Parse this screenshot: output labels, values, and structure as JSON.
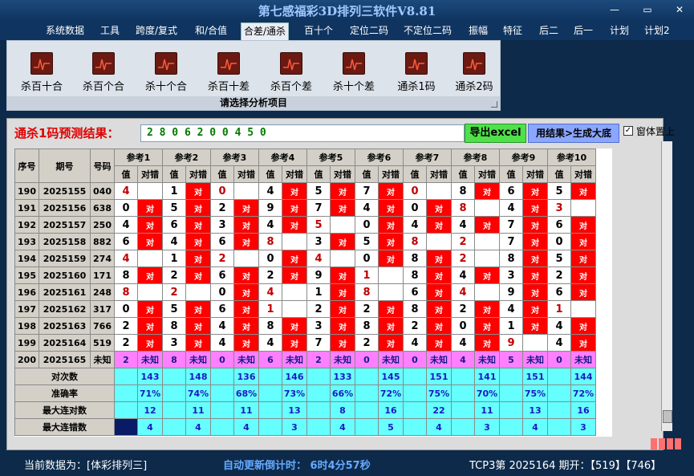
{
  "window": {
    "title": "第七感福彩3D排列三软件V8.81"
  },
  "menu": [
    "系统数据",
    "工具",
    "跨度/复式",
    "和/合值",
    "合差/通杀",
    "百十个",
    "定位二码",
    "不定位二码",
    "振幅",
    "特征",
    "后二",
    "后一",
    "计划",
    "计划2"
  ],
  "menu_active": 4,
  "ribbon": {
    "buttons": [
      "杀百十合",
      "杀百个合",
      "杀十个合",
      "杀百十差",
      "杀百个差",
      "杀十个差",
      "通杀1码",
      "通杀2码"
    ],
    "caption": "请选择分析项目"
  },
  "prediction": {
    "label": "通杀1码预测结果：",
    "value": "2 8 0 6 2 0 0 4 5 0",
    "export_label": "导出excel",
    "generate_label": "用结果>生成大底",
    "ontop_label": "窗体置上",
    "ontop_checked": true
  },
  "table": {
    "headers": {
      "seq": "序号",
      "period": "期号",
      "code": "号码",
      "value": "值",
      "check": "对错"
    },
    "ref_groups": [
      "参考1",
      "参考2",
      "参考3",
      "参考4",
      "参考5",
      "参考6",
      "参考7",
      "参考8",
      "参考9",
      "参考10"
    ],
    "hit_label": "对",
    "unknown_label": "未知",
    "rows": [
      {
        "seq": "190",
        "period": "2025155",
        "code": "040",
        "vals": [
          "4",
          "1",
          "0",
          "4",
          "5",
          "7",
          "0",
          "8",
          "6",
          "5"
        ],
        "hits": [
          0,
          1,
          0,
          1,
          1,
          1,
          0,
          1,
          1,
          1
        ]
      },
      {
        "seq": "191",
        "period": "2025156",
        "code": "638",
        "vals": [
          "0",
          "5",
          "2",
          "9",
          "7",
          "4",
          "0",
          "8",
          "4",
          "3"
        ],
        "hits": [
          1,
          1,
          1,
          1,
          1,
          1,
          1,
          0,
          1,
          0
        ]
      },
      {
        "seq": "192",
        "period": "2025157",
        "code": "250",
        "vals": [
          "4",
          "6",
          "3",
          "4",
          "5",
          "0",
          "4",
          "4",
          "7",
          "6"
        ],
        "hits": [
          1,
          1,
          1,
          1,
          0,
          1,
          1,
          1,
          1,
          1
        ]
      },
      {
        "seq": "193",
        "period": "2025158",
        "code": "882",
        "vals": [
          "6",
          "4",
          "6",
          "8",
          "3",
          "5",
          "8",
          "2",
          "7",
          "0"
        ],
        "hits": [
          1,
          1,
          1,
          0,
          1,
          1,
          0,
          0,
          1,
          1
        ]
      },
      {
        "seq": "194",
        "period": "2025159",
        "code": "274",
        "vals": [
          "4",
          "1",
          "2",
          "0",
          "4",
          "0",
          "8",
          "2",
          "8",
          "5"
        ],
        "hits": [
          0,
          1,
          0,
          1,
          0,
          1,
          1,
          0,
          1,
          1
        ]
      },
      {
        "seq": "195",
        "period": "2025160",
        "code": "171",
        "vals": [
          "8",
          "2",
          "6",
          "2",
          "9",
          "1",
          "8",
          "4",
          "3",
          "2"
        ],
        "hits": [
          1,
          1,
          1,
          1,
          1,
          0,
          1,
          1,
          1,
          1
        ]
      },
      {
        "seq": "196",
        "period": "2025161",
        "code": "248",
        "vals": [
          "8",
          "2",
          "0",
          "4",
          "1",
          "8",
          "6",
          "4",
          "9",
          "6"
        ],
        "hits": [
          0,
          0,
          1,
          0,
          1,
          0,
          1,
          0,
          1,
          1
        ]
      },
      {
        "seq": "197",
        "period": "2025162",
        "code": "317",
        "vals": [
          "0",
          "5",
          "6",
          "1",
          "2",
          "2",
          "8",
          "2",
          "4",
          "1"
        ],
        "hits": [
          1,
          1,
          1,
          0,
          1,
          1,
          1,
          1,
          1,
          0
        ]
      },
      {
        "seq": "198",
        "period": "2025163",
        "code": "766",
        "vals": [
          "2",
          "8",
          "4",
          "8",
          "3",
          "8",
          "2",
          "0",
          "1",
          "4"
        ],
        "hits": [
          1,
          1,
          1,
          1,
          1,
          1,
          1,
          1,
          1,
          1
        ]
      },
      {
        "seq": "199",
        "period": "2025164",
        "code": "519",
        "vals": [
          "2",
          "3",
          "4",
          "4",
          "7",
          "2",
          "4",
          "4",
          "9",
          "4"
        ],
        "hits": [
          1,
          1,
          1,
          1,
          1,
          1,
          1,
          1,
          0,
          1
        ]
      },
      {
        "seq": "200",
        "period": "2025165",
        "code": "未知",
        "vals": [
          "2",
          "8",
          "0",
          "6",
          "2",
          "0",
          "0",
          "4",
          "5",
          "0"
        ],
        "hits": []
      }
    ],
    "stats": [
      {
        "label": "对次数",
        "vals": [
          "143",
          "148",
          "136",
          "146",
          "133",
          "145",
          "151",
          "141",
          "151",
          "144"
        ]
      },
      {
        "label": "准确率",
        "vals": [
          "71%",
          "74%",
          "68%",
          "73%",
          "66%",
          "72%",
          "75%",
          "70%",
          "75%",
          "72%"
        ]
      },
      {
        "label": "最大连对数",
        "vals": [
          "12",
          "11",
          "11",
          "13",
          "8",
          "16",
          "22",
          "11",
          "13",
          "16"
        ]
      },
      {
        "label": "最大连错数",
        "vals": [
          "4",
          "4",
          "4",
          "3",
          "4",
          "5",
          "4",
          "3",
          "4",
          "3"
        ]
      }
    ]
  },
  "status": {
    "source": "当前数据为：[体彩排列三]",
    "timer": "自动更新倒计时：  6时4分57秒",
    "draw": "TCP3第 2025164 期开：【519】【746】"
  },
  "colors": {
    "hit_red": "#ff0000",
    "pred_row": "#ff80ff",
    "stat_row": "#66ffff"
  }
}
